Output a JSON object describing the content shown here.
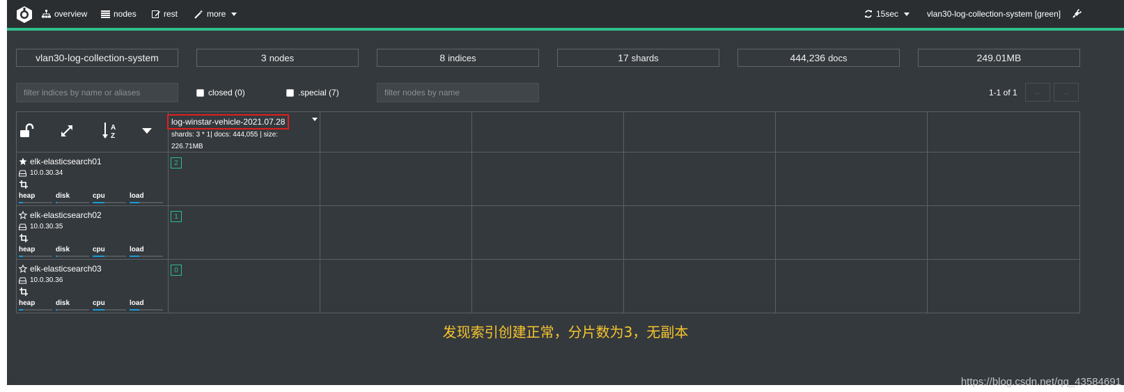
{
  "navbar": {
    "items": [
      {
        "label": "overview",
        "icon": "sitemap-icon"
      },
      {
        "label": "nodes",
        "icon": "list-icon"
      },
      {
        "label": "rest",
        "icon": "edit-icon"
      },
      {
        "label": "more",
        "icon": "magic-wand-icon"
      }
    ],
    "refresh_label": "15sec",
    "cluster_label": "vlan30-log-collection-system [green]",
    "accent_color": "#2fbe8c"
  },
  "stats": {
    "cluster_name": "vlan30-log-collection-system",
    "nodes_count": "3",
    "nodes_unit": "nodes",
    "indices_count": "8",
    "indices_unit": "indices",
    "shards_count": "17",
    "shards_unit": "shards",
    "docs_count": "444,236",
    "docs_unit": "docs",
    "size": "249.01MB"
  },
  "filters": {
    "indices_placeholder": "filter indices by name or aliases",
    "closed_label": "closed (0)",
    "special_label": ".special (7)",
    "nodes_placeholder": "filter nodes by name",
    "pager_text": "1-1 of 1",
    "prev_label": "←",
    "next_label": "→"
  },
  "index": {
    "name": "log-winstar-vehicle-2021.07.28",
    "meta": "shards: 3 * 1| docs: 444,055 | size: 226.71MB"
  },
  "metric_labels": {
    "heap": "heap",
    "disk": "disk",
    "cpu": "cpu",
    "load": "load"
  },
  "nodes": [
    {
      "name": "elk-elasticsearch01",
      "ip": "10.0.30.34",
      "master": true,
      "shard": "2",
      "metrics": {
        "heap": 0.12,
        "disk": 0.05,
        "cpu": 0.35,
        "load": 0.3
      }
    },
    {
      "name": "elk-elasticsearch02",
      "ip": "10.0.30.35",
      "master": false,
      "shard": "1",
      "metrics": {
        "heap": 0.12,
        "disk": 0.05,
        "cpu": 0.35,
        "load": 0.3
      }
    },
    {
      "name": "elk-elasticsearch03",
      "ip": "10.0.30.36",
      "master": false,
      "shard": "0",
      "metrics": {
        "heap": 0.12,
        "disk": 0.05,
        "cpu": 0.35,
        "load": 0.3
      }
    }
  ],
  "annotation": "发现索引创建正常，分片数为3，无副本",
  "watermark": "https://blog.csdn.net/qq_43584691"
}
